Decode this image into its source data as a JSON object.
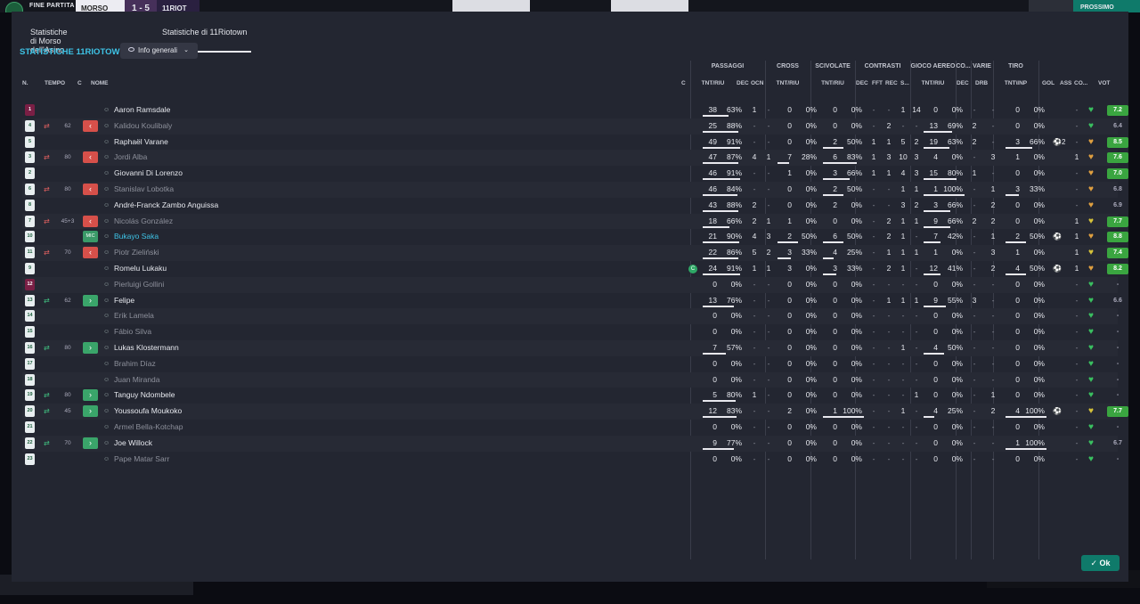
{
  "topbar": {
    "status": "FINE PARTITA",
    "team1": "MORSO",
    "score": "1 - 5",
    "team2": "11RIOT",
    "right_button": "PROSSIMO"
  },
  "tabs": [
    {
      "label": "Statistiche di Morso dell'Asino"
    },
    {
      "label": "Statistiche di 11Riotown"
    }
  ],
  "section_title": "STATISTICHE 11RIOTOWN",
  "dropdown": {
    "label": "Info generali"
  },
  "group_headers": {
    "passaggi": "PASSAGGI",
    "cross": "CROSS",
    "scivolate": "SCIVOLATE",
    "contrasti": "CONTRASTI",
    "gioco_aereo": "GIOCO AEREO",
    "co": "CO...",
    "varie": "VARIE",
    "tiro": "TIRO"
  },
  "col_headers": {
    "n": "N.",
    "tempo": "TEMPO",
    "c": "C",
    "nome": "NOME",
    "cap": "C",
    "tnt_riu": "TNT/RIU",
    "dec": "DEC",
    "ocn": "OCN",
    "cross_tnt": "TNT/RIU",
    "sciv_tnt": "TNT/RIU",
    "con_dec": "DEC",
    "fft": "FFT",
    "rec": "REC",
    "s": "S...",
    "aer_tnt": "TNT/RIU",
    "co_dec": "DEC",
    "drb": "DRB",
    "tiro_tnt": "TNT\\INP",
    "gol": "GOL",
    "ass": "ASS",
    "co2": "CO...",
    "vot": "VOT"
  },
  "players": [
    {
      "num": "1",
      "mins": "",
      "sub": "",
      "name": "Aaron Ramsdale",
      "dim": false,
      "gk": true,
      "pass": [
        "38",
        "63%"
      ],
      "pf": 0.63,
      "dec": "1",
      "ocn": "-",
      "cross": [
        "0",
        "0%"
      ],
      "cf": 0,
      "sciv": [
        "0",
        "0%"
      ],
      "sf": 0,
      "con": [
        "-",
        "-",
        "1",
        "14"
      ],
      "aer": [
        "0",
        "0%"
      ],
      "af": 0,
      "cdec": "-",
      "drb": "-",
      "tiro": [
        "0",
        "0%"
      ],
      "tf": 0,
      "gol": "",
      "ass": "-",
      "heart": "g",
      "vot": "7.2",
      "vg": true
    },
    {
      "num": "4",
      "mins": "62",
      "sub": "out",
      "name": "Kalidou Koulibaly",
      "dim": true,
      "gk": false,
      "pass": [
        "25",
        "88%"
      ],
      "pf": 0.88,
      "dec": "-",
      "ocn": "-",
      "cross": [
        "0",
        "0%"
      ],
      "cf": 0,
      "sciv": [
        "0",
        "0%"
      ],
      "sf": 0,
      "con": [
        "-",
        "2",
        "-",
        "-"
      ],
      "aer": [
        "13",
        "69%"
      ],
      "af": 0.69,
      "cdec": "2",
      "drb": "-",
      "tiro": [
        "0",
        "0%"
      ],
      "tf": 0,
      "gol": "",
      "ass": "-",
      "heart": "g",
      "vot": "6.4",
      "vg": false
    },
    {
      "num": "5",
      "mins": "",
      "sub": "",
      "name": "Raphaël Varane",
      "dim": false,
      "gk": false,
      "pass": [
        "49",
        "91%"
      ],
      "pf": 0.91,
      "dec": "-",
      "ocn": "-",
      "cross": [
        "0",
        "0%"
      ],
      "cf": 0,
      "sciv": [
        "2",
        "50%"
      ],
      "sf": 0.5,
      "con": [
        "1",
        "1",
        "5",
        "2"
      ],
      "aer": [
        "19",
        "63%"
      ],
      "af": 0.63,
      "cdec": "2",
      "drb": "-",
      "tiro": [
        "3",
        "66%"
      ],
      "tf": 0.66,
      "gol": "⚽2",
      "ass": "-",
      "heart": "o",
      "vot": "8.5",
      "vg": true
    },
    {
      "num": "3",
      "mins": "80",
      "sub": "out",
      "name": "Jordi Alba",
      "dim": true,
      "gk": false,
      "pass": [
        "47",
        "87%"
      ],
      "pf": 0.87,
      "dec": "4",
      "ocn": "1",
      "cross": [
        "7",
        "28%"
      ],
      "cf": 0.28,
      "sciv": [
        "6",
        "83%"
      ],
      "sf": 0.83,
      "con": [
        "1",
        "3",
        "10",
        "3"
      ],
      "aer": [
        "4",
        "0%"
      ],
      "af": 0,
      "cdec": "-",
      "drb": "3",
      "tiro": [
        "1",
        "0%"
      ],
      "tf": 0,
      "gol": "",
      "ass": "1",
      "heart": "o",
      "vot": "7.6",
      "vg": true
    },
    {
      "num": "2",
      "mins": "",
      "sub": "",
      "name": "Giovanni Di Lorenzo",
      "dim": false,
      "gk": false,
      "pass": [
        "46",
        "91%"
      ],
      "pf": 0.91,
      "dec": "-",
      "ocn": "-",
      "cross": [
        "1",
        "0%"
      ],
      "cf": 0,
      "sciv": [
        "3",
        "66%"
      ],
      "sf": 0.66,
      "con": [
        "1",
        "1",
        "4",
        "3"
      ],
      "aer": [
        "15",
        "80%"
      ],
      "af": 0.8,
      "cdec": "1",
      "drb": "-",
      "tiro": [
        "0",
        "0%"
      ],
      "tf": 0,
      "gol": "",
      "ass": "-",
      "heart": "o",
      "vot": "7.0",
      "vg": true
    },
    {
      "num": "6",
      "mins": "80",
      "sub": "out",
      "name": "Stanislav Lobotka",
      "dim": true,
      "gk": false,
      "pass": [
        "46",
        "84%"
      ],
      "pf": 0.84,
      "dec": "-",
      "ocn": "-",
      "cross": [
        "0",
        "0%"
      ],
      "cf": 0,
      "sciv": [
        "2",
        "50%"
      ],
      "sf": 0.5,
      "con": [
        "-",
        "-",
        "1",
        "1"
      ],
      "aer": [
        "1",
        "100%"
      ],
      "af": 1,
      "cdec": "-",
      "drb": "1",
      "tiro": [
        "3",
        "33%"
      ],
      "tf": 0.33,
      "gol": "",
      "ass": "-",
      "heart": "o",
      "vot": "6.8",
      "vg": false
    },
    {
      "num": "8",
      "mins": "",
      "sub": "",
      "name": "André-Franck Zambo Anguissa",
      "dim": false,
      "gk": false,
      "pass": [
        "43",
        "88%"
      ],
      "pf": 0.88,
      "dec": "2",
      "ocn": "-",
      "cross": [
        "0",
        "0%"
      ],
      "cf": 0,
      "sciv": [
        "2",
        "0%"
      ],
      "sf": 0,
      "con": [
        "-",
        "-",
        "3",
        "2"
      ],
      "aer": [
        "3",
        "66%"
      ],
      "af": 0.66,
      "cdec": "-",
      "drb": "2",
      "tiro": [
        "0",
        "0%"
      ],
      "tf": 0,
      "gol": "",
      "ass": "-",
      "heart": "o",
      "vot": "6.9",
      "vg": false
    },
    {
      "num": "7",
      "mins": "45+3",
      "sub": "out",
      "name": "Nicolás González",
      "dim": true,
      "gk": false,
      "pass": [
        "18",
        "66%"
      ],
      "pf": 0.66,
      "dec": "2",
      "ocn": "1",
      "cross": [
        "1",
        "0%"
      ],
      "cf": 0,
      "sciv": [
        "0",
        "0%"
      ],
      "sf": 0,
      "con": [
        "-",
        "2",
        "1",
        "1"
      ],
      "aer": [
        "9",
        "66%"
      ],
      "af": 0.66,
      "cdec": "2",
      "drb": "2",
      "tiro": [
        "0",
        "0%"
      ],
      "tf": 0,
      "gol": "",
      "ass": "1",
      "heart": "y",
      "vot": "7.7",
      "vg": true
    },
    {
      "num": "10",
      "mins": "",
      "sub": "mic",
      "name": "Bukayo Saka",
      "dim": false,
      "hl": true,
      "gk": false,
      "pass": [
        "21",
        "90%"
      ],
      "pf": 0.9,
      "dec": "4",
      "ocn": "3",
      "cross": [
        "2",
        "50%"
      ],
      "cf": 0.5,
      "sciv": [
        "6",
        "50%"
      ],
      "sf": 0.5,
      "con": [
        "-",
        "2",
        "1",
        "-"
      ],
      "aer": [
        "7",
        "42%"
      ],
      "af": 0.42,
      "cdec": "-",
      "drb": "1",
      "tiro": [
        "2",
        "50%"
      ],
      "tf": 0.5,
      "gol": "⚽",
      "ass": "1",
      "heart": "o",
      "vot": "8.8",
      "vg": true
    },
    {
      "num": "11",
      "mins": "70",
      "sub": "out",
      "name": "Piotr Zieliński",
      "dim": true,
      "gk": false,
      "pass": [
        "22",
        "86%"
      ],
      "pf": 0.86,
      "dec": "5",
      "ocn": "2",
      "cross": [
        "3",
        "33%"
      ],
      "cf": 0.33,
      "sciv": [
        "4",
        "25%"
      ],
      "sf": 0.25,
      "con": [
        "-",
        "1",
        "1",
        "1"
      ],
      "aer": [
        "1",
        "0%"
      ],
      "af": 0,
      "cdec": "-",
      "drb": "3",
      "tiro": [
        "1",
        "0%"
      ],
      "tf": 0,
      "gol": "",
      "ass": "1",
      "heart": "y",
      "vot": "7.4",
      "vg": true
    },
    {
      "num": "9",
      "mins": "",
      "sub": "",
      "name": "Romelu Lukaku",
      "dim": false,
      "gk": false,
      "cap": true,
      "pass": [
        "24",
        "91%"
      ],
      "pf": 0.91,
      "dec": "1",
      "ocn": "1",
      "cross": [
        "3",
        "0%"
      ],
      "cf": 0,
      "sciv": [
        "3",
        "33%"
      ],
      "sf": 0.33,
      "con": [
        "-",
        "2",
        "1",
        "-"
      ],
      "aer": [
        "12",
        "41%"
      ],
      "af": 0.41,
      "cdec": "-",
      "drb": "2",
      "tiro": [
        "4",
        "50%"
      ],
      "tf": 0.5,
      "gol": "⚽",
      "ass": "1",
      "heart": "o",
      "vot": "8.2",
      "vg": true
    },
    {
      "num": "12",
      "mins": "",
      "sub": "",
      "name": "Pierluigi Gollini",
      "dim": true,
      "gk": true,
      "pass": [
        "0",
        "0%"
      ],
      "pf": 0,
      "dec": "-",
      "ocn": "-",
      "cross": [
        "0",
        "0%"
      ],
      "cf": 0,
      "sciv": [
        "0",
        "0%"
      ],
      "sf": 0,
      "con": [
        "-",
        "-",
        "-",
        "-"
      ],
      "aer": [
        "0",
        "0%"
      ],
      "af": 0,
      "cdec": "-",
      "drb": "-",
      "tiro": [
        "0",
        "0%"
      ],
      "tf": 0,
      "gol": "",
      "ass": "-",
      "heart": "g",
      "vot": "-",
      "vg": false
    },
    {
      "num": "13",
      "mins": "62",
      "sub": "in",
      "name": "Felipe",
      "dim": false,
      "gk": false,
      "pass": [
        "13",
        "76%"
      ],
      "pf": 0.76,
      "dec": "-",
      "ocn": "-",
      "cross": [
        "0",
        "0%"
      ],
      "cf": 0,
      "sciv": [
        "0",
        "0%"
      ],
      "sf": 0,
      "con": [
        "-",
        "1",
        "1",
        "1"
      ],
      "aer": [
        "9",
        "55%"
      ],
      "af": 0.55,
      "cdec": "3",
      "drb": "-",
      "tiro": [
        "0",
        "0%"
      ],
      "tf": 0,
      "gol": "",
      "ass": "-",
      "heart": "g",
      "vot": "6.6",
      "vg": false
    },
    {
      "num": "14",
      "mins": "",
      "sub": "",
      "name": "Erik Lamela",
      "dim": true,
      "gk": false,
      "pass": [
        "0",
        "0%"
      ],
      "pf": 0,
      "dec": "-",
      "ocn": "-",
      "cross": [
        "0",
        "0%"
      ],
      "cf": 0,
      "sciv": [
        "0",
        "0%"
      ],
      "sf": 0,
      "con": [
        "-",
        "-",
        "-",
        "-"
      ],
      "aer": [
        "0",
        "0%"
      ],
      "af": 0,
      "cdec": "-",
      "drb": "-",
      "tiro": [
        "0",
        "0%"
      ],
      "tf": 0,
      "gol": "",
      "ass": "-",
      "heart": "g",
      "vot": "-",
      "vg": false
    },
    {
      "num": "15",
      "mins": "",
      "sub": "",
      "name": "Fábio Silva",
      "dim": true,
      "gk": false,
      "pass": [
        "0",
        "0%"
      ],
      "pf": 0,
      "dec": "-",
      "ocn": "-",
      "cross": [
        "0",
        "0%"
      ],
      "cf": 0,
      "sciv": [
        "0",
        "0%"
      ],
      "sf": 0,
      "con": [
        "-",
        "-",
        "-",
        "-"
      ],
      "aer": [
        "0",
        "0%"
      ],
      "af": 0,
      "cdec": "-",
      "drb": "-",
      "tiro": [
        "0",
        "0%"
      ],
      "tf": 0,
      "gol": "",
      "ass": "-",
      "heart": "g",
      "vot": "-",
      "vg": false
    },
    {
      "num": "16",
      "mins": "80",
      "sub": "in",
      "name": "Lukas Klostermann",
      "dim": false,
      "gk": false,
      "pass": [
        "7",
        "57%"
      ],
      "pf": 0.57,
      "dec": "-",
      "ocn": "-",
      "cross": [
        "0",
        "0%"
      ],
      "cf": 0,
      "sciv": [
        "0",
        "0%"
      ],
      "sf": 0,
      "con": [
        "-",
        "-",
        "1",
        "-"
      ],
      "aer": [
        "4",
        "50%"
      ],
      "af": 0.5,
      "cdec": "-",
      "drb": "-",
      "tiro": [
        "0",
        "0%"
      ],
      "tf": 0,
      "gol": "",
      "ass": "-",
      "heart": "g",
      "vot": "-",
      "vg": false
    },
    {
      "num": "17",
      "mins": "",
      "sub": "",
      "name": "Brahim Díaz",
      "dim": true,
      "gk": false,
      "pass": [
        "0",
        "0%"
      ],
      "pf": 0,
      "dec": "-",
      "ocn": "-",
      "cross": [
        "0",
        "0%"
      ],
      "cf": 0,
      "sciv": [
        "0",
        "0%"
      ],
      "sf": 0,
      "con": [
        "-",
        "-",
        "-",
        "-"
      ],
      "aer": [
        "0",
        "0%"
      ],
      "af": 0,
      "cdec": "-",
      "drb": "-",
      "tiro": [
        "0",
        "0%"
      ],
      "tf": 0,
      "gol": "",
      "ass": "-",
      "heart": "g",
      "vot": "-",
      "vg": false
    },
    {
      "num": "18",
      "mins": "",
      "sub": "",
      "name": "Juan Miranda",
      "dim": true,
      "gk": false,
      "pass": [
        "0",
        "0%"
      ],
      "pf": 0,
      "dec": "-",
      "ocn": "-",
      "cross": [
        "0",
        "0%"
      ],
      "cf": 0,
      "sciv": [
        "0",
        "0%"
      ],
      "sf": 0,
      "con": [
        "-",
        "-",
        "-",
        "-"
      ],
      "aer": [
        "0",
        "0%"
      ],
      "af": 0,
      "cdec": "-",
      "drb": "-",
      "tiro": [
        "0",
        "0%"
      ],
      "tf": 0,
      "gol": "",
      "ass": "-",
      "heart": "g",
      "vot": "-",
      "vg": false
    },
    {
      "num": "19",
      "mins": "80",
      "sub": "in",
      "name": "Tanguy Ndombele",
      "dim": false,
      "gk": false,
      "pass": [
        "5",
        "80%"
      ],
      "pf": 0.8,
      "dec": "1",
      "ocn": "-",
      "cross": [
        "0",
        "0%"
      ],
      "cf": 0,
      "sciv": [
        "0",
        "0%"
      ],
      "sf": 0,
      "con": [
        "-",
        "-",
        "-",
        "1"
      ],
      "aer": [
        "0",
        "0%"
      ],
      "af": 0,
      "cdec": "-",
      "drb": "1",
      "tiro": [
        "0",
        "0%"
      ],
      "tf": 0,
      "gol": "",
      "ass": "-",
      "heart": "g",
      "vot": "-",
      "vg": false
    },
    {
      "num": "20",
      "mins": "45",
      "sub": "in",
      "name": "Youssoufa Moukoko",
      "dim": false,
      "gk": false,
      "pass": [
        "12",
        "83%"
      ],
      "pf": 0.83,
      "dec": "-",
      "ocn": "-",
      "cross": [
        "2",
        "0%"
      ],
      "cf": 0,
      "sciv": [
        "1",
        "100%"
      ],
      "sf": 1,
      "con": [
        "-",
        "-",
        "1",
        "-"
      ],
      "aer": [
        "4",
        "25%"
      ],
      "af": 0.25,
      "cdec": "-",
      "drb": "2",
      "tiro": [
        "4",
        "100%"
      ],
      "tf": 1,
      "gol": "⚽",
      "ass": "-",
      "heart": "y",
      "vot": "7.7",
      "vg": true
    },
    {
      "num": "21",
      "mins": "",
      "sub": "",
      "name": "Armel Bella-Kotchap",
      "dim": true,
      "gk": false,
      "pass": [
        "0",
        "0%"
      ],
      "pf": 0,
      "dec": "-",
      "ocn": "-",
      "cross": [
        "0",
        "0%"
      ],
      "cf": 0,
      "sciv": [
        "0",
        "0%"
      ],
      "sf": 0,
      "con": [
        "-",
        "-",
        "-",
        "-"
      ],
      "aer": [
        "0",
        "0%"
      ],
      "af": 0,
      "cdec": "-",
      "drb": "-",
      "tiro": [
        "0",
        "0%"
      ],
      "tf": 0,
      "gol": "",
      "ass": "-",
      "heart": "g",
      "vot": "-",
      "vg": false
    },
    {
      "num": "22",
      "mins": "70",
      "sub": "in",
      "name": "Joe Willock",
      "dim": false,
      "gk": false,
      "pass": [
        "9",
        "77%"
      ],
      "pf": 0.77,
      "dec": "-",
      "ocn": "-",
      "cross": [
        "0",
        "0%"
      ],
      "cf": 0,
      "sciv": [
        "0",
        "0%"
      ],
      "sf": 0,
      "con": [
        "-",
        "-",
        "-",
        "-"
      ],
      "aer": [
        "0",
        "0%"
      ],
      "af": 0,
      "cdec": "-",
      "drb": "-",
      "tiro": [
        "1",
        "100%"
      ],
      "tf": 1,
      "gol": "",
      "ass": "-",
      "heart": "g",
      "vot": "6.7",
      "vg": false
    },
    {
      "num": "23",
      "mins": "",
      "sub": "",
      "name": "Pape Matar Sarr",
      "dim": true,
      "gk": false,
      "pass": [
        "0",
        "0%"
      ],
      "pf": 0,
      "dec": "-",
      "ocn": "-",
      "cross": [
        "0",
        "0%"
      ],
      "cf": 0,
      "sciv": [
        "0",
        "0%"
      ],
      "sf": 0,
      "con": [
        "-",
        "-",
        "-",
        "-"
      ],
      "aer": [
        "0",
        "0%"
      ],
      "af": 0,
      "cdec": "-",
      "drb": "-",
      "tiro": [
        "0",
        "0%"
      ],
      "tf": 0,
      "gol": "",
      "ass": "-",
      "heart": "g",
      "vot": "-",
      "vg": false
    }
  ],
  "ok_button": "Ok",
  "colors": {
    "accent": "#3ec3e6",
    "green": "#3aa540",
    "red": "#d6504a",
    "teal": "#0f7a6a"
  }
}
